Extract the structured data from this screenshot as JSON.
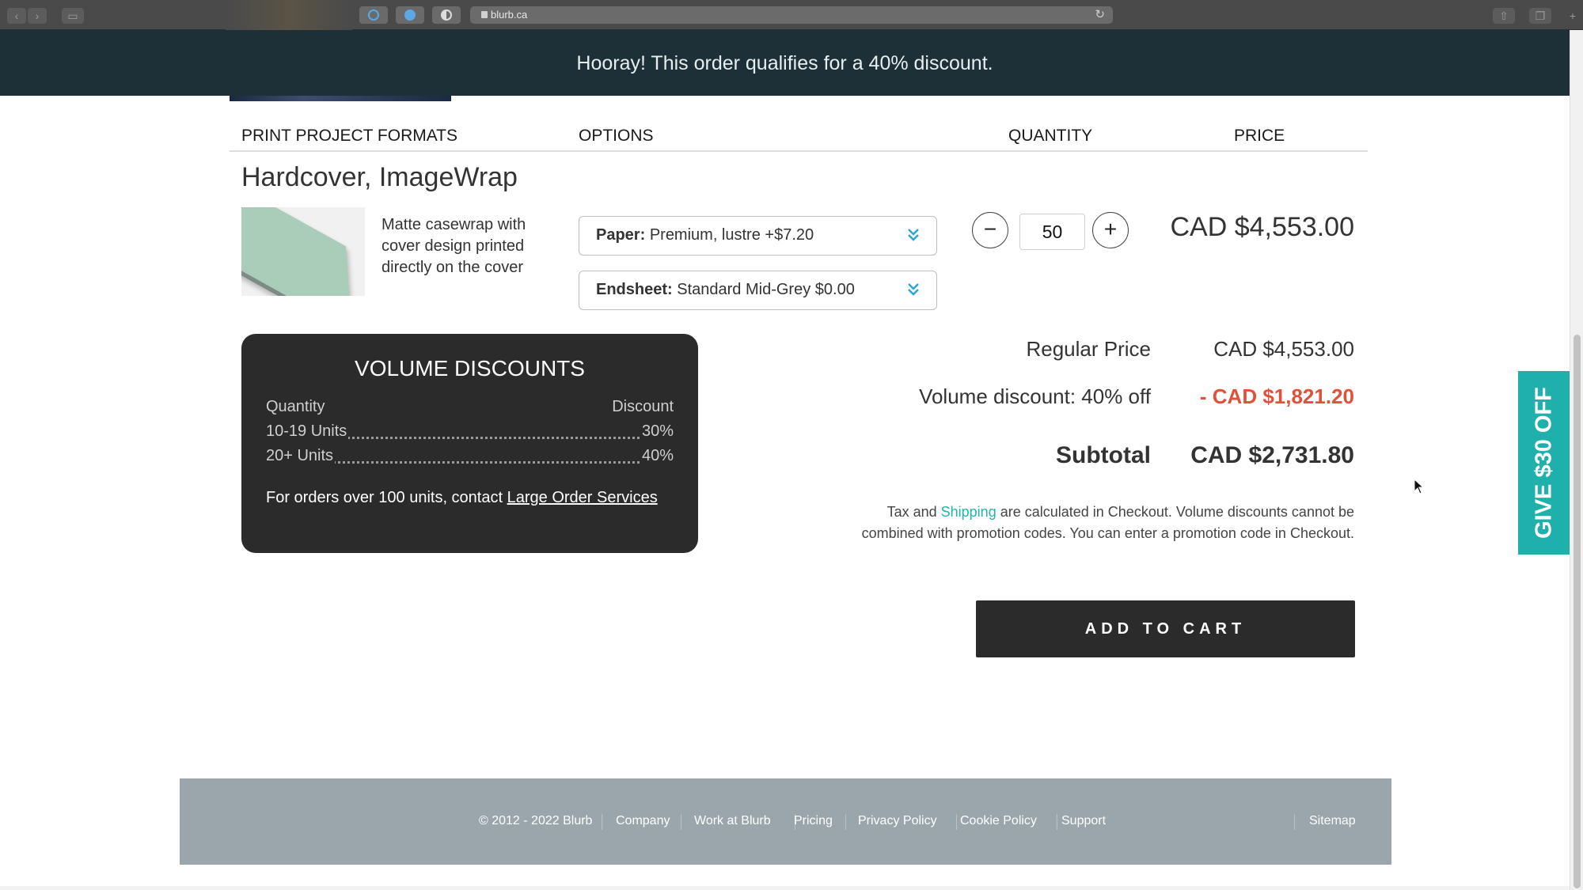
{
  "browser": {
    "url": "blurb.ca"
  },
  "banner": {
    "message": "Hooray! This order qualifies for a 40% discount."
  },
  "table_header": {
    "formats": "PRINT PROJECT FORMATS",
    "options": "OPTIONS",
    "quantity": "QUANTITY",
    "price": "PRICE"
  },
  "product": {
    "title": "Hardcover, ImageWrap",
    "description": "Matte casewrap with cover design printed directly on the cover",
    "paper": {
      "label": "Paper:",
      "value": "Premium, lustre +$7.20"
    },
    "endsheet": {
      "label": "Endsheet:",
      "value": "Standard Mid-Grey $0.00"
    },
    "quantity": "50",
    "minus": "−",
    "plus": "+",
    "price": "CAD $4,553.00"
  },
  "volume_discounts": {
    "title": "VOLUME DISCOUNTS",
    "col_quantity": "Quantity",
    "col_discount": "Discount",
    "tiers": [
      {
        "units": "10-19 Units",
        "discount": "30%"
      },
      {
        "units": "20+ Units",
        "discount": "40%"
      }
    ],
    "contact_text": "For orders over 100 units, contact",
    "contact_link": "Large Order Services"
  },
  "summary": {
    "regular_label": "Regular Price",
    "regular_value": "CAD $4,553.00",
    "discount_label": "Volume discount: 40% off",
    "discount_value": "- CAD $1,821.20",
    "subtotal_label": "Subtotal",
    "subtotal_value": "CAD $2,731.80",
    "note_prefix": "Tax and",
    "note_link": "Shipping",
    "note_suffix": "are calculated in Checkout. Volume discounts cannot be combined with promotion codes. You can enter a promotion code in Checkout."
  },
  "add_to_cart": "ADD TO CART",
  "side_tab": "GIVE $30 OFF",
  "footer": {
    "copyright": "© 2012 - 2022 Blurb",
    "company": "Company",
    "work": "Work at Blurb",
    "pricing": "Pricing",
    "privacy": "Privacy Policy",
    "cookie": "Cookie Policy",
    "support": "Support",
    "sitemap": "Sitemap"
  },
  "colors": {
    "banner": "#1d3038",
    "accent": "#1fb0ac",
    "discount": "#e0513a",
    "dark_box": "#2b2b2b"
  }
}
